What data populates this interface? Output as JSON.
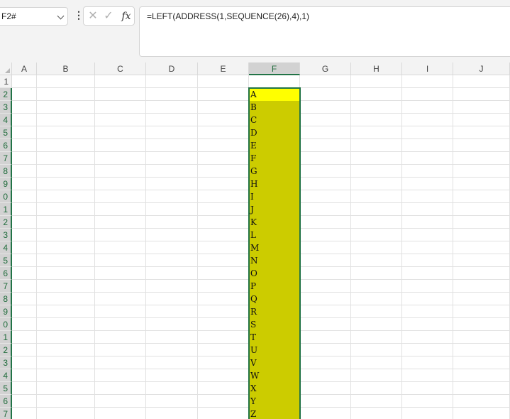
{
  "namebox": {
    "value": "F2#"
  },
  "more_icon": "⋮",
  "formula_buttons": {
    "cancel": "✕",
    "enter": "✓",
    "fx": "fx"
  },
  "formula": {
    "text": "=LEFT(ADDRESS(1,SEQUENCE(26),4),1)"
  },
  "columns": [
    "A",
    "B",
    "C",
    "D",
    "E",
    "F",
    "G",
    "H",
    "I",
    "J"
  ],
  "selected_column": "F",
  "rows": [
    "1",
    "2",
    "3",
    "4",
    "5",
    "6",
    "7",
    "8",
    "9",
    "0",
    "1",
    "2",
    "3",
    "4",
    "5",
    "6",
    "7",
    "8",
    "9",
    "0",
    "1",
    "2",
    "3",
    "4",
    "5",
    "6",
    "7"
  ],
  "column_f_values": [
    "A",
    "B",
    "C",
    "D",
    "E",
    "F",
    "G",
    "H",
    "I",
    "J",
    "K",
    "L",
    "M",
    "N",
    "O",
    "P",
    "Q",
    "R",
    "S",
    "T",
    "U",
    "V",
    "W",
    "X",
    "Y",
    "Z"
  ],
  "colors": {
    "active_cell": "#ffff00",
    "spill_fill": "#cccc00",
    "selection_border": "#217346"
  }
}
